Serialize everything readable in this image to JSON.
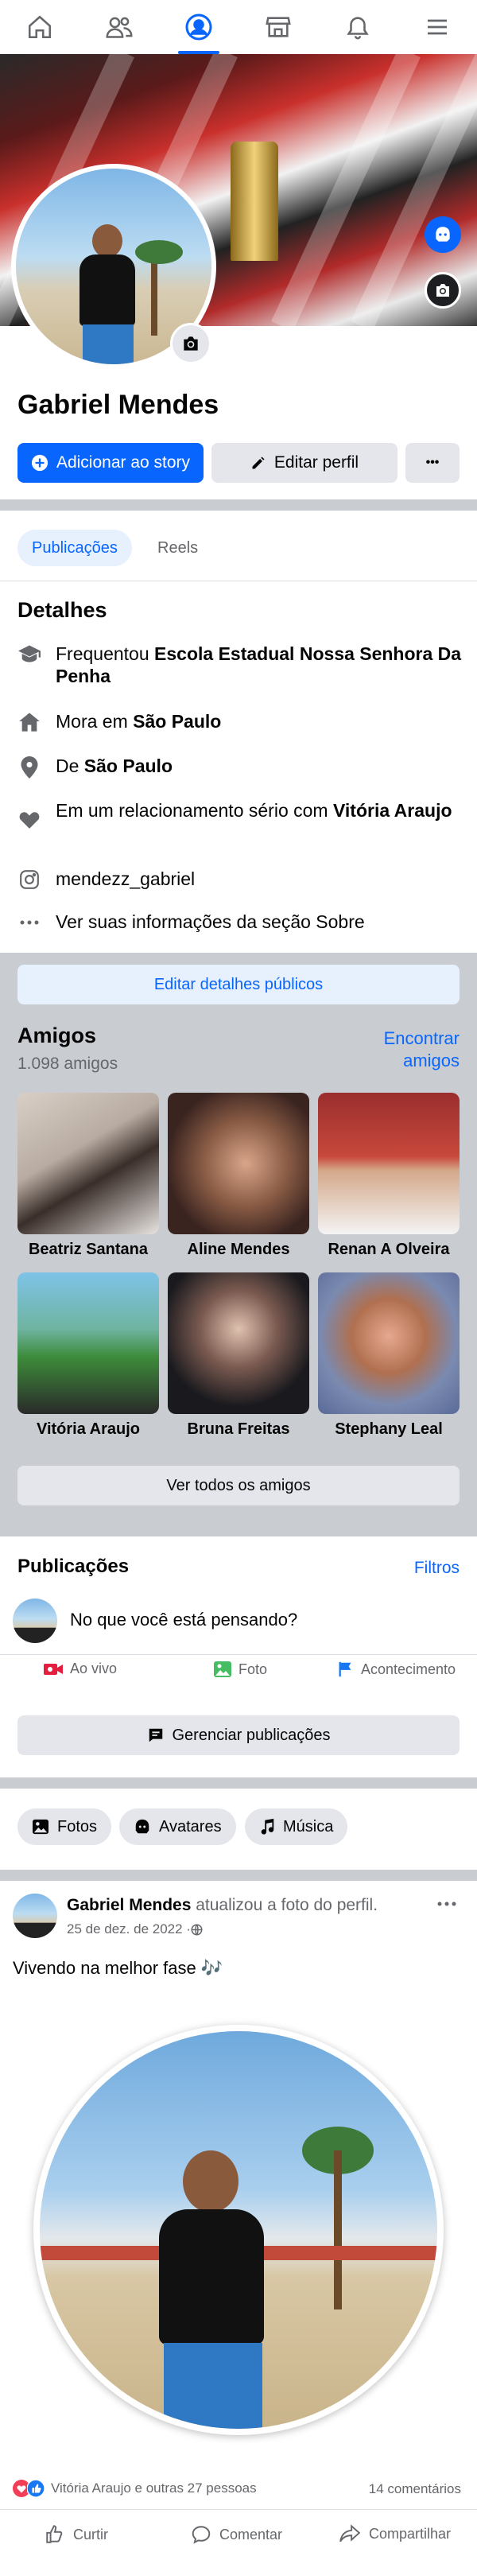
{
  "nav": {
    "items": [
      {
        "name": "home",
        "icon": "home-icon"
      },
      {
        "name": "friends",
        "icon": "friends-icon"
      },
      {
        "name": "profile",
        "icon": "profile-icon"
      },
      {
        "name": "marketplace",
        "icon": "marketplace-icon"
      },
      {
        "name": "notifications",
        "icon": "bell-icon"
      },
      {
        "name": "menu",
        "icon": "menu-icon"
      }
    ],
    "active": "profile",
    "accent": "#0866ff"
  },
  "profile": {
    "name": "Gabriel Mendes",
    "add_story_label": "Adicionar ao story",
    "edit_profile_label": "Editar perfil",
    "more_label": "•••"
  },
  "tabs": [
    "Publicações",
    "Reels"
  ],
  "details": {
    "title": "Detalhes",
    "study_prefix": "Frequentou ",
    "study_place": "Escola Estadual Nossa Senhora Da Penha",
    "lives_prefix": "Mora em ",
    "lives_place": "São Paulo",
    "from_prefix": "De ",
    "from_place": "São Paulo",
    "relationship_prefix": "Em um relacionamento sério com ",
    "relationship_partner": "Vitória Araujo",
    "instagram": "mendezz_gabriel",
    "see_about": "Ver suas informações da seção Sobre",
    "edit_public_label": "Editar detalhes públicos"
  },
  "friends": {
    "title": "Amigos",
    "count": "1.098 amigos",
    "find_label_1": "Encontrar",
    "find_label_2": "amigos",
    "list": [
      {
        "name": "Beatriz Santana"
      },
      {
        "name": "Aline Mendes"
      },
      {
        "name": "Renan A Olveira"
      },
      {
        "name": "Vitória Araujo"
      },
      {
        "name": "Bruna Freitas"
      },
      {
        "name": "Stephany Leal"
      }
    ],
    "see_all_label": "Ver todos os amigos"
  },
  "posts": {
    "title": "Publicações",
    "filters_label": "Filtros",
    "composer_placeholder": "No que você está pensando?",
    "live_label": "Ao vivo",
    "photo_label": "Foto",
    "event_label": "Acontecimento",
    "manage_label": "Gerenciar publicações"
  },
  "chips": [
    "Fotos",
    "Avatares",
    "Música"
  ],
  "post": {
    "author": "Gabriel Mendes",
    "action": " atualizou a foto do perfil.",
    "date": "25 de dez. de 2022 · ",
    "text": "Vivendo na melhor fase 🎶",
    "reactions_text": "Vitória Araujo e outras 27 pessoas",
    "comments_text": "14 comentários",
    "like_label": "Curtir",
    "comment_label": "Comentar",
    "share_label": "Compartilhar"
  }
}
